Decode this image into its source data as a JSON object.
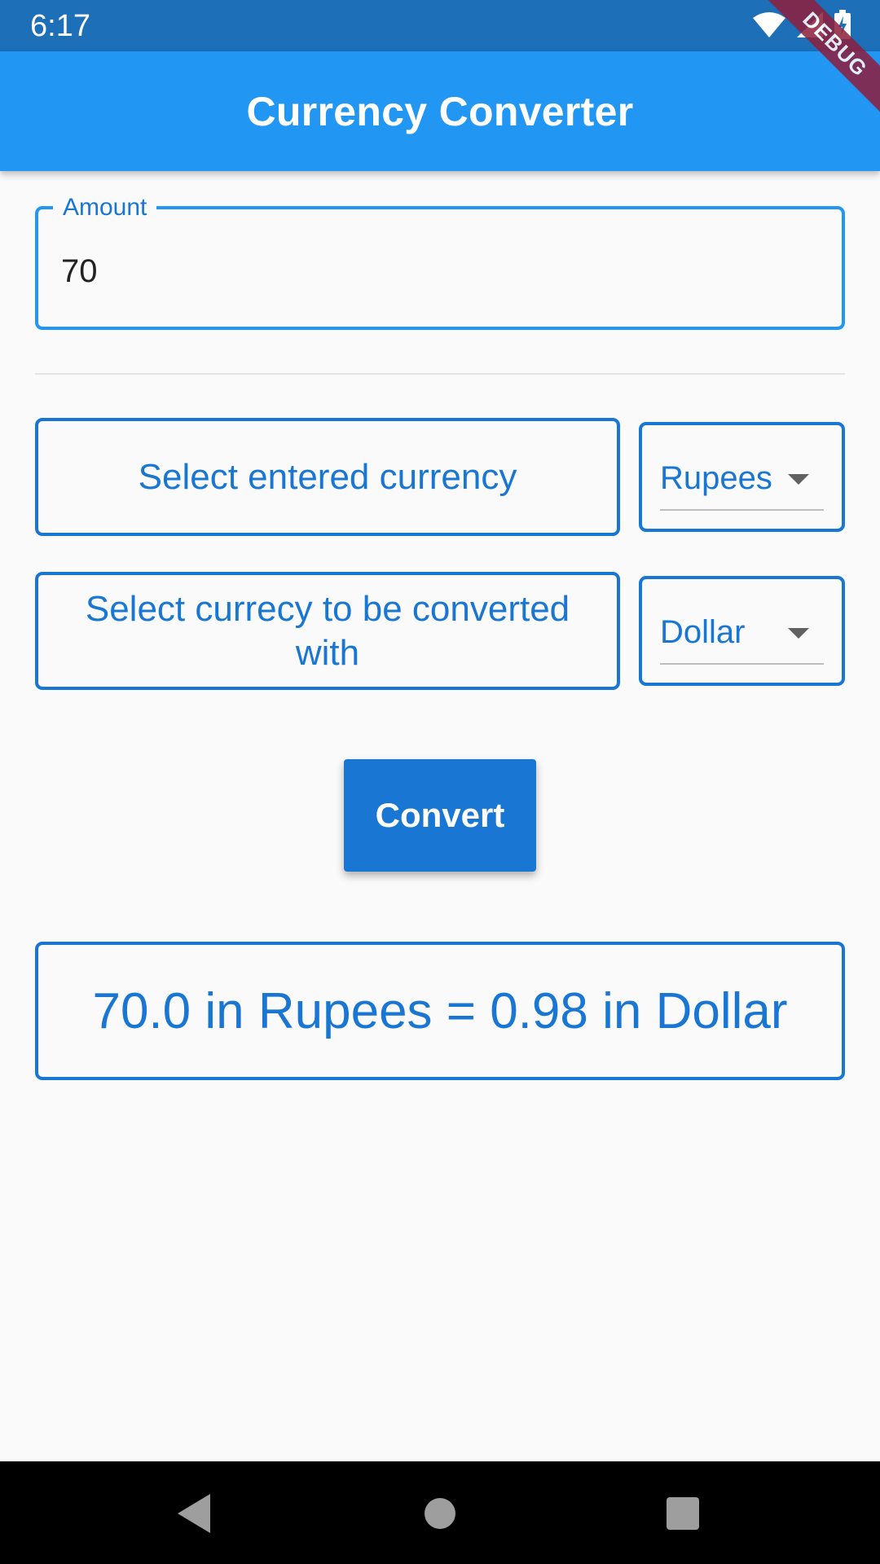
{
  "status_bar": {
    "time": "6:17",
    "icons": [
      "wifi-icon",
      "cell-signal-icon",
      "battery-charging-icon"
    ]
  },
  "debug_banner": "DEBUG",
  "app_bar": {
    "title": "Currency Converter"
  },
  "amount": {
    "label": "Amount",
    "value": "70"
  },
  "from_row": {
    "label": "Select entered currency",
    "selected": "Rupees"
  },
  "to_row": {
    "label": "Select currecy to be converted with",
    "selected": "Dollar"
  },
  "convert_button": {
    "label": "Convert"
  },
  "result": {
    "text": "70.0 in Rupees = 0.98 in Dollar"
  },
  "nav_bar": {
    "icons": [
      "back-icon",
      "home-icon",
      "recents-icon"
    ]
  },
  "colors": {
    "status_bar": "#1d6fb8",
    "app_bar": "#2196f3",
    "accent": "#1976d2",
    "background": "#fafafa"
  }
}
